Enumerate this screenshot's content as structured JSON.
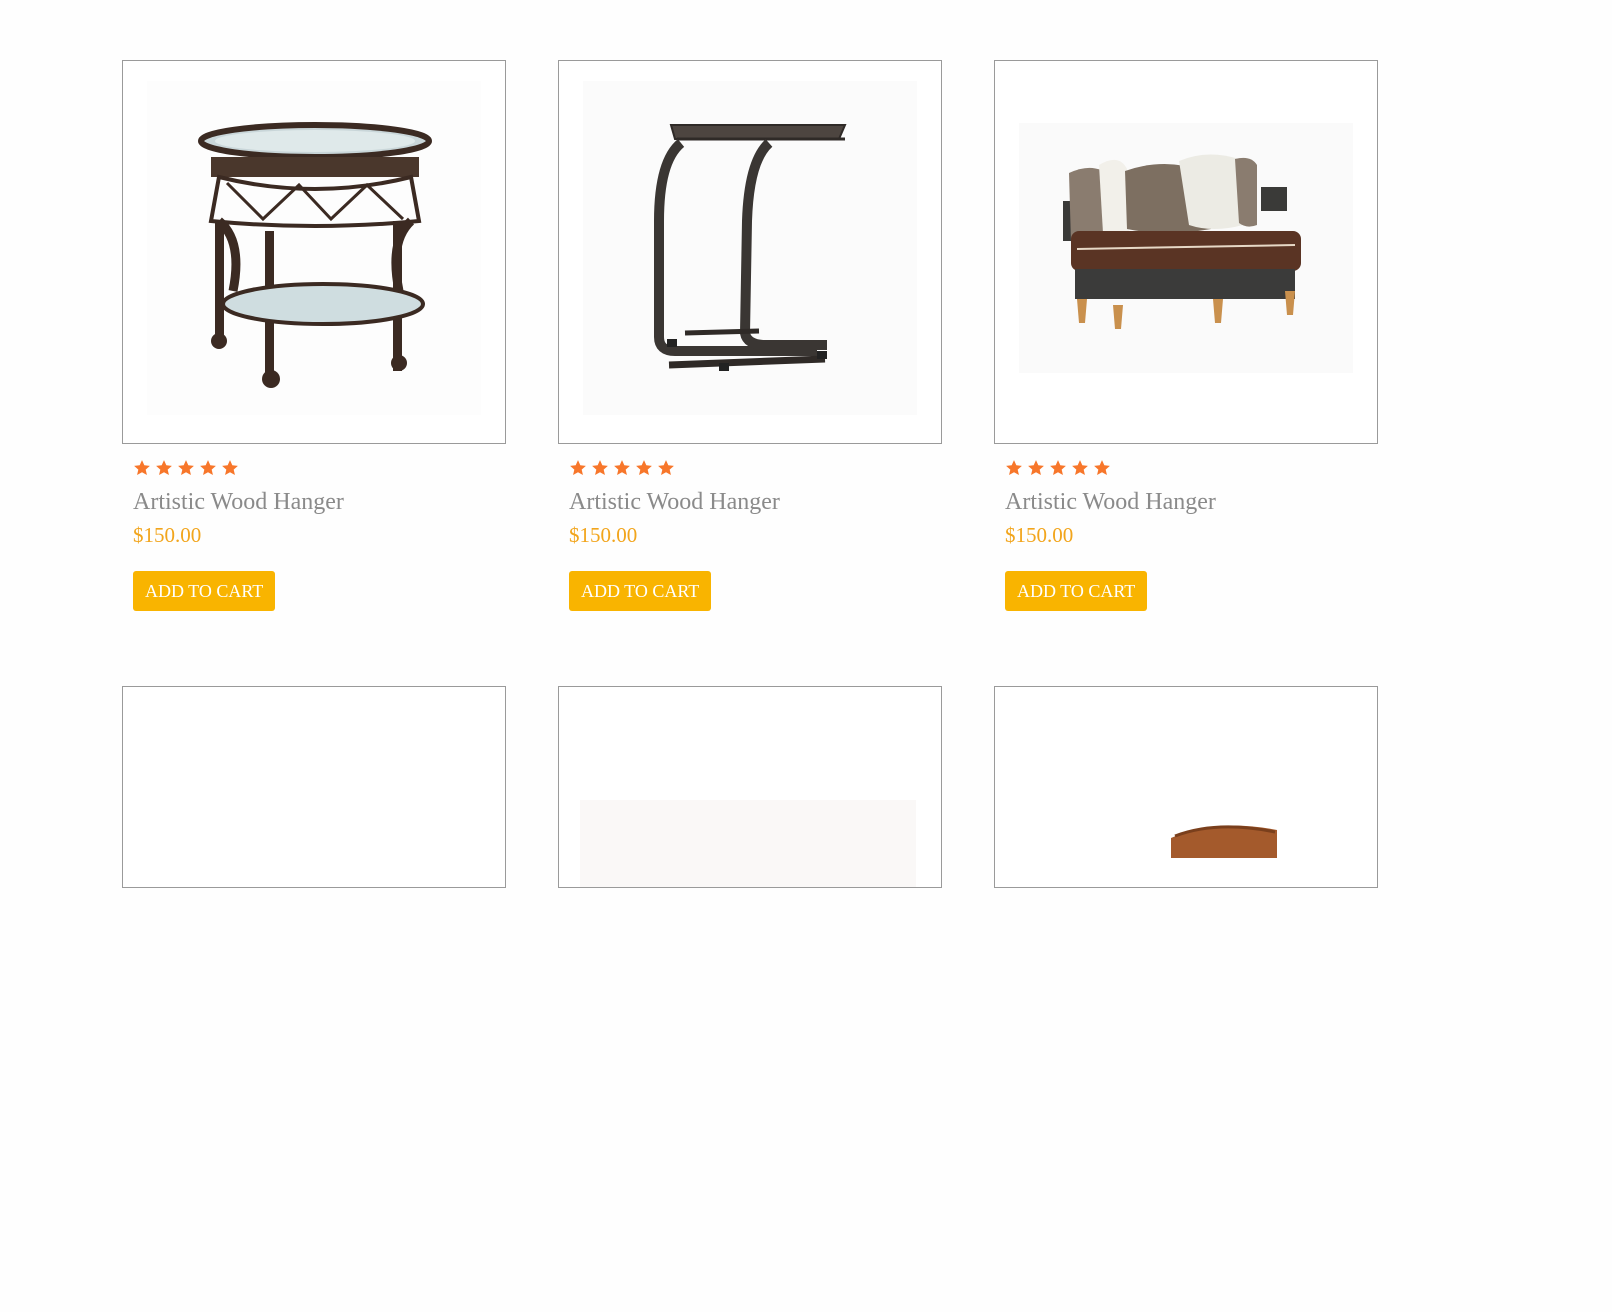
{
  "products": [
    {
      "image": "wicker-side-table",
      "rating": 5,
      "title": "Artistic Wood Hanger",
      "price": "$150.00",
      "cta": "ADD TO CART"
    },
    {
      "image": "c-shaped-side-table",
      "rating": 5,
      "title": "Artistic Wood Hanger",
      "price": "$150.00",
      "cta": "ADD TO CART"
    },
    {
      "image": "sofa-with-pillows",
      "rating": 5,
      "title": "Artistic Wood Hanger",
      "price": "$150.00",
      "cta": "ADD TO CART"
    }
  ],
  "second_row": [
    {
      "image": "blank-product-image"
    },
    {
      "image": "light-product-image"
    },
    {
      "image": "wicker-chair"
    }
  ],
  "colors": {
    "star": "#f7762a",
    "price": "#f2a51c",
    "button": "#f9b400",
    "title": "#8a8a8a"
  },
  "icons": {
    "star": "star-icon"
  }
}
